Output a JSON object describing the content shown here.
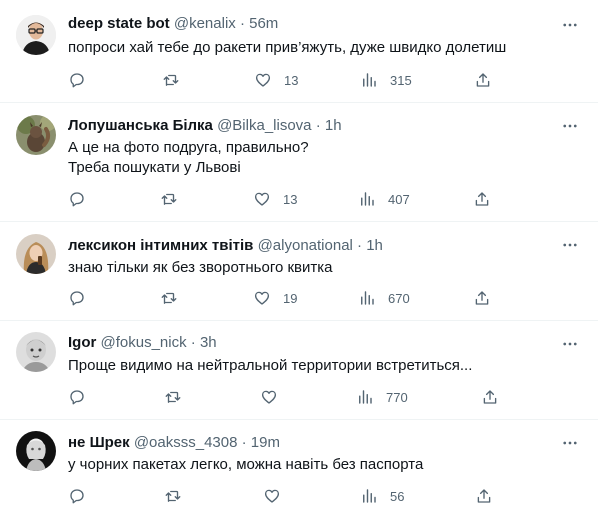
{
  "tweets": [
    {
      "name": "deep state bot",
      "handle": "@kenalix",
      "sep": "·",
      "time": "56m",
      "lines": [
        "попроси хай тебе до ракети прив’яжуть, дуже швидко долетиш"
      ],
      "likes": "13",
      "views": "315",
      "avatar_icon": "avatar-man-glasses"
    },
    {
      "name": "Лопушанська Білка",
      "handle": "@Bilka_lisova",
      "sep": "·",
      "time": "1h",
      "lines": [
        "А це на фото подруга, правильно?",
        "Треба пошукати у Львові"
      ],
      "likes": "13",
      "views": "407",
      "avatar_icon": "avatar-squirrel"
    },
    {
      "name": "лексикон інтимних твітів",
      "handle": "@alyonational",
      "sep": "·",
      "time": "1h",
      "lines": [
        "знаю тільки як без зворотнього квитка"
      ],
      "likes": "19",
      "views": "670",
      "avatar_icon": "avatar-woman"
    },
    {
      "name": "Igor",
      "handle": "@fokus_nick",
      "sep": "·",
      "time": "3h",
      "lines": [
        "Проще видимо на нейтральной территории встретиться..."
      ],
      "likes": "",
      "views": "770",
      "avatar_icon": "avatar-child"
    },
    {
      "name": "не Шрек",
      "handle": "@oaksss_4308",
      "sep": "·",
      "time": "19m",
      "lines": [
        "у чорних пакетах легко, можна навіть без паспорта"
      ],
      "likes": "",
      "views": "56",
      "avatar_icon": "avatar-statue"
    }
  ],
  "icons": {
    "reply": "reply-icon",
    "retweet": "retweet-icon",
    "like": "like-icon",
    "views": "views-icon",
    "share": "share-icon",
    "more": "more-icon"
  },
  "colors": {
    "text": "#0f1419",
    "secondary": "#536471",
    "border": "#eff3f4"
  }
}
